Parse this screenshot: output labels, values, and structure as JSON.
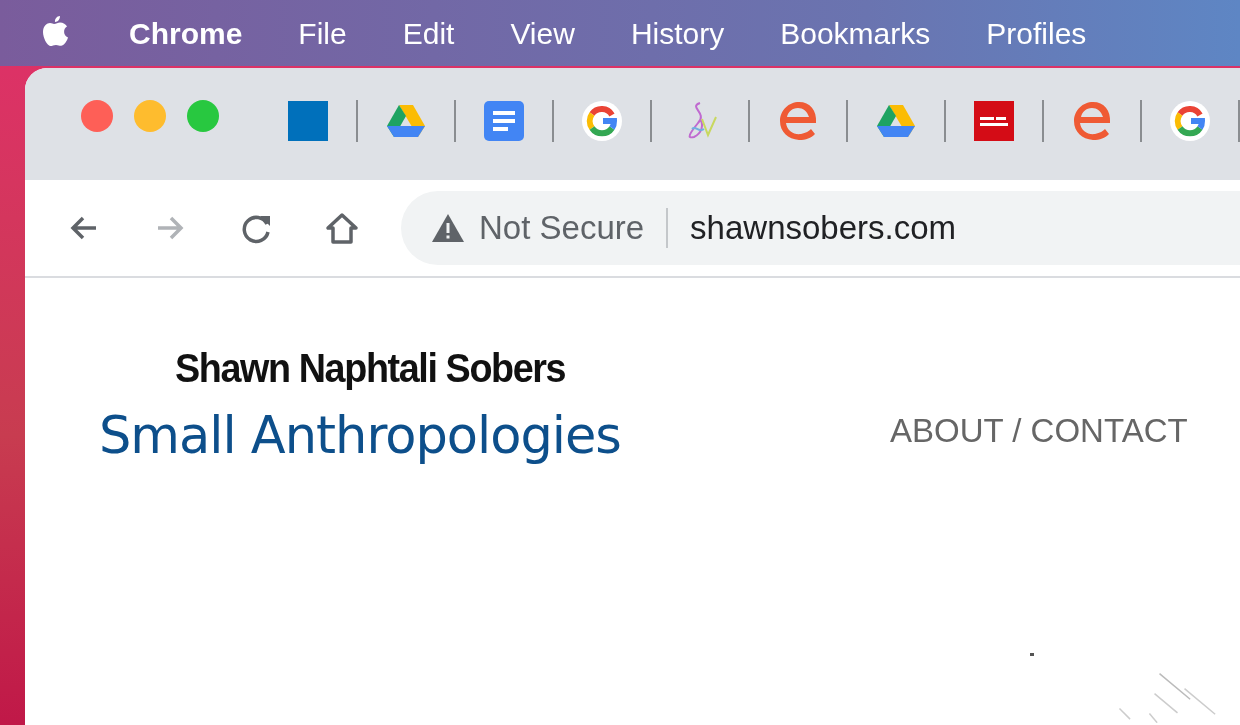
{
  "menu_bar": {
    "items": [
      {
        "label": "Chrome",
        "kind": "app"
      },
      {
        "label": "File",
        "kind": "menu"
      },
      {
        "label": "Edit",
        "kind": "menu"
      },
      {
        "label": "View",
        "kind": "menu"
      },
      {
        "label": "History",
        "kind": "menu"
      },
      {
        "label": "Bookmarks",
        "kind": "menu"
      },
      {
        "label": "Profiles",
        "kind": "menu"
      }
    ]
  },
  "bookmarks": [
    {
      "kind": "square"
    },
    {
      "kind": "drive"
    },
    {
      "kind": "docs"
    },
    {
      "kind": "google"
    },
    {
      "kind": "swirl"
    },
    {
      "kind": "e"
    },
    {
      "kind": "drive"
    },
    {
      "kind": "redtile"
    },
    {
      "kind": "e"
    },
    {
      "kind": "google"
    }
  ],
  "nav_buttons": [
    {
      "kind": "back",
      "disabled": false
    },
    {
      "kind": "forward",
      "disabled": true
    },
    {
      "kind": "reload",
      "disabled": false
    },
    {
      "kind": "home",
      "disabled": false
    }
  ],
  "address_bar": {
    "security": "Not Secure",
    "url": "shawnsobers.com"
  },
  "page": {
    "title": "Shawn Naphtali Sobers",
    "subtitle": "Small Anthropologies",
    "nav_link": "ABOUT / CONTACT"
  }
}
